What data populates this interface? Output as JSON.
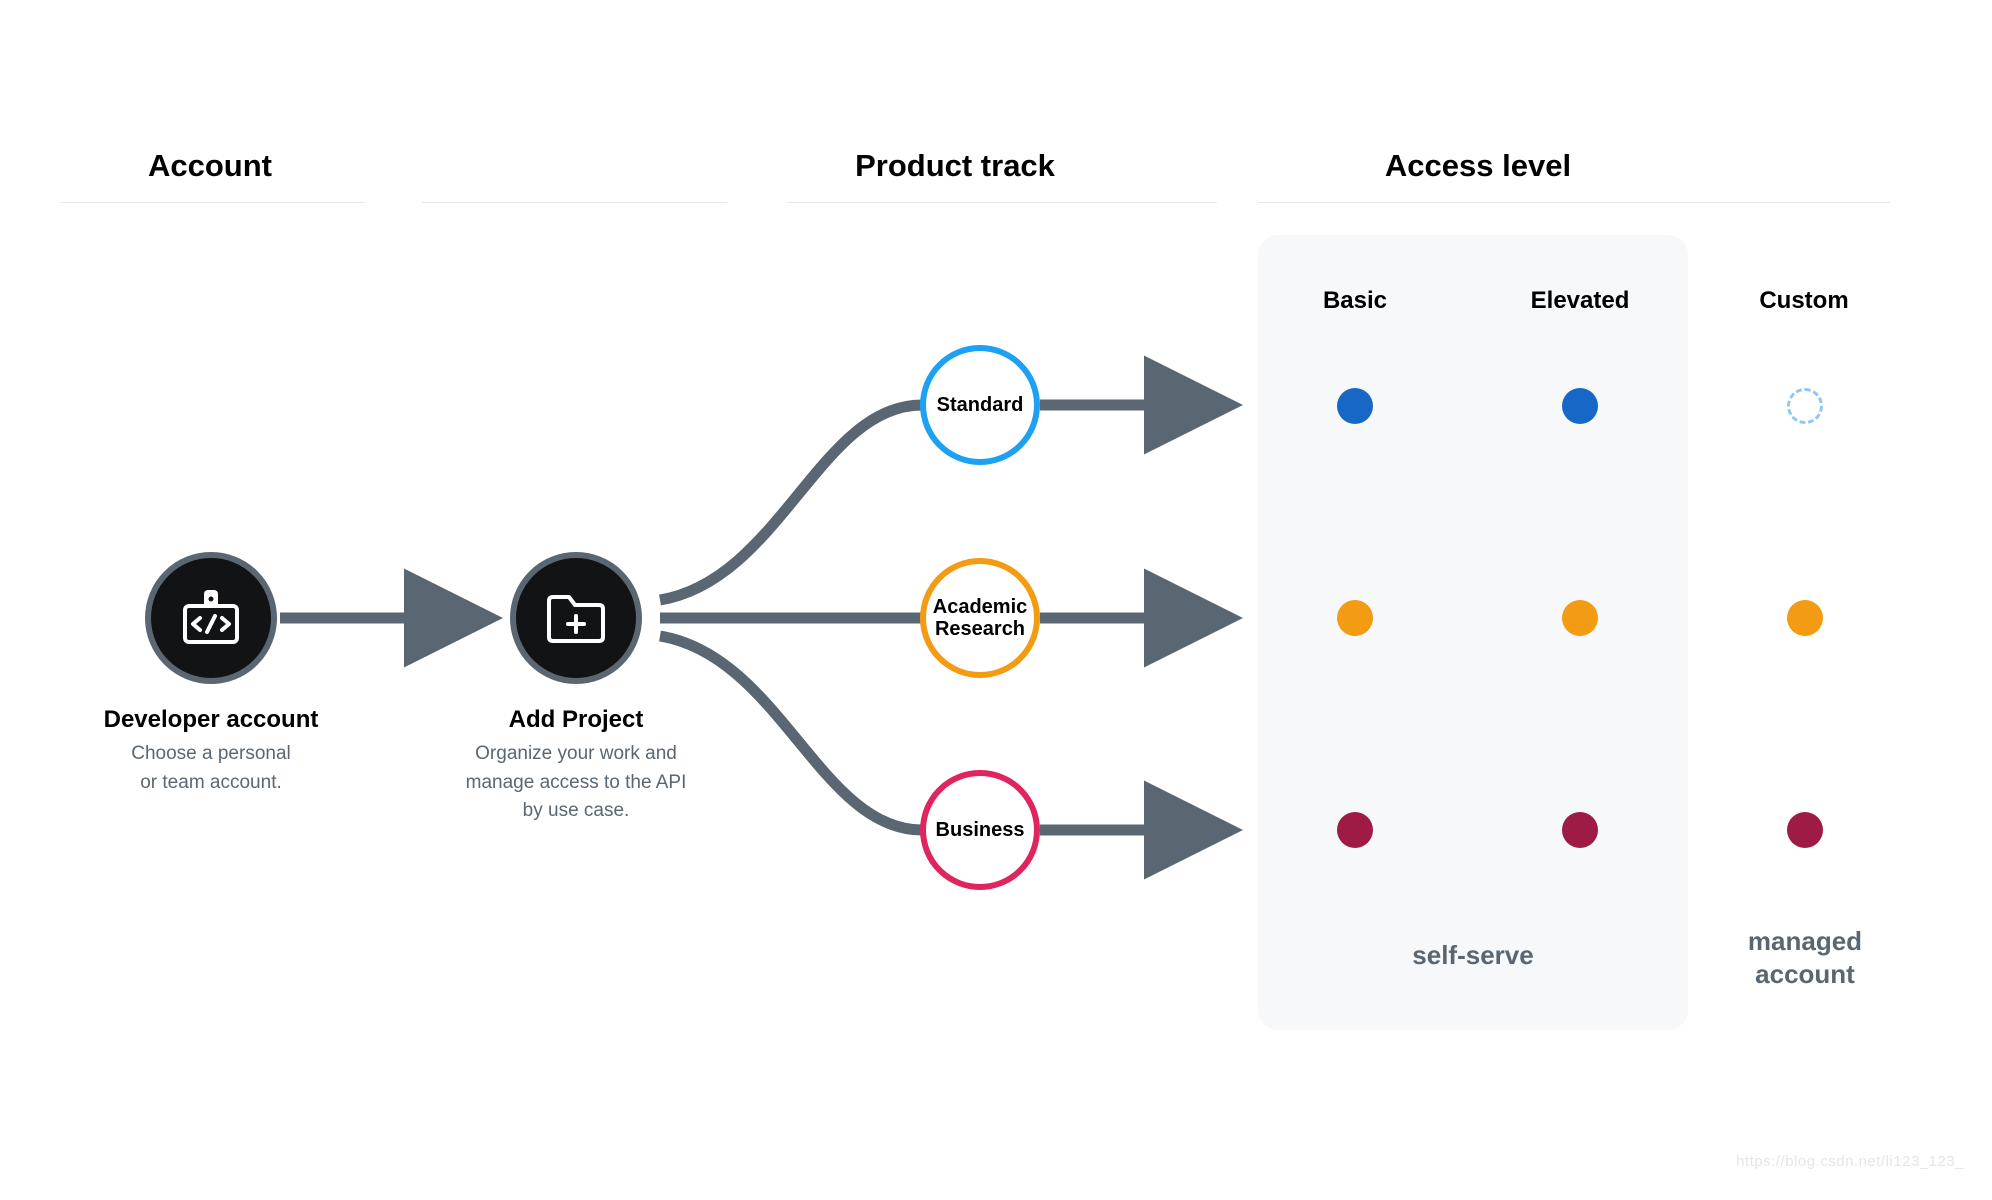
{
  "columns": {
    "account": "Account",
    "product_track": "Product track",
    "access_level": "Access level"
  },
  "account": {
    "title": "Developer account",
    "sub1": "Choose a personal",
    "sub2": "or team account."
  },
  "project": {
    "title": "Add Project",
    "sub1": "Organize your work and",
    "sub2": "manage access to the API",
    "sub3": "by use case."
  },
  "tracks": {
    "standard": "Standard",
    "academic_l1": "Academic",
    "academic_l2": "Research",
    "business": "Business"
  },
  "access_headers": {
    "basic": "Basic",
    "elevated": "Elevated",
    "custom": "Custom"
  },
  "access_footer": {
    "self_serve": "self-serve",
    "managed_l1": "managed",
    "managed_l2": "account"
  },
  "colors": {
    "arrow": "#5a6772",
    "standard": "#1da1f2",
    "academic": "#f39b12",
    "business": "#e0245e",
    "dot_blue": "#1767c6",
    "dot_orange": "#f39b12",
    "dot_crimson": "#9e1b46",
    "dot_blue_outline": "#8fc9f0"
  },
  "watermark": "https://blog.csdn.net/li123_123_"
}
